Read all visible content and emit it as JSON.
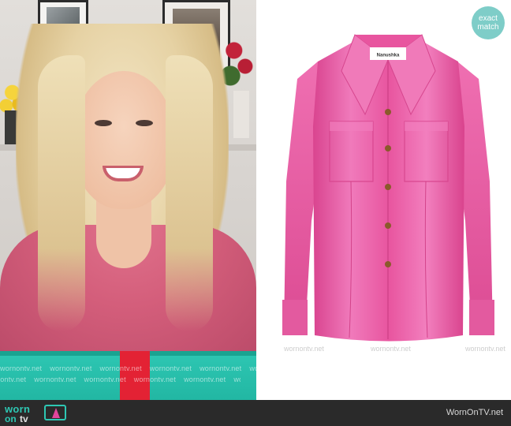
{
  "badge": {
    "line1": "exact",
    "line2": "match"
  },
  "product": {
    "brand_label": "Nanushka"
  },
  "watermarks": {
    "ticker_row1": [
      "wornontv.net",
      "wornontv.net",
      "wornontv.net",
      "wornontv.net",
      "wornontv.net",
      "wornontv.net"
    ],
    "ticker_row2": [
      "wornontv.net",
      "wornontv.net",
      "wornontv.net",
      "wornontv.net",
      "wornontv.net",
      "wornontv.net"
    ],
    "product_left": "wornontv.net",
    "product_mid": "wornontv.net",
    "product_right": "wornontv.net"
  },
  "footer": {
    "logo_line1": "worn",
    "logo_line2_a": "on",
    "logo_line2_b": "tv",
    "site": "WornOnTV.net"
  },
  "colors": {
    "shirt_pink": "#e8559f",
    "ticker_teal": "#2ec7b3",
    "ticker_red": "#e32234",
    "footer_bg": "#2a2a2a",
    "badge_bg": "#7ecdc8"
  }
}
